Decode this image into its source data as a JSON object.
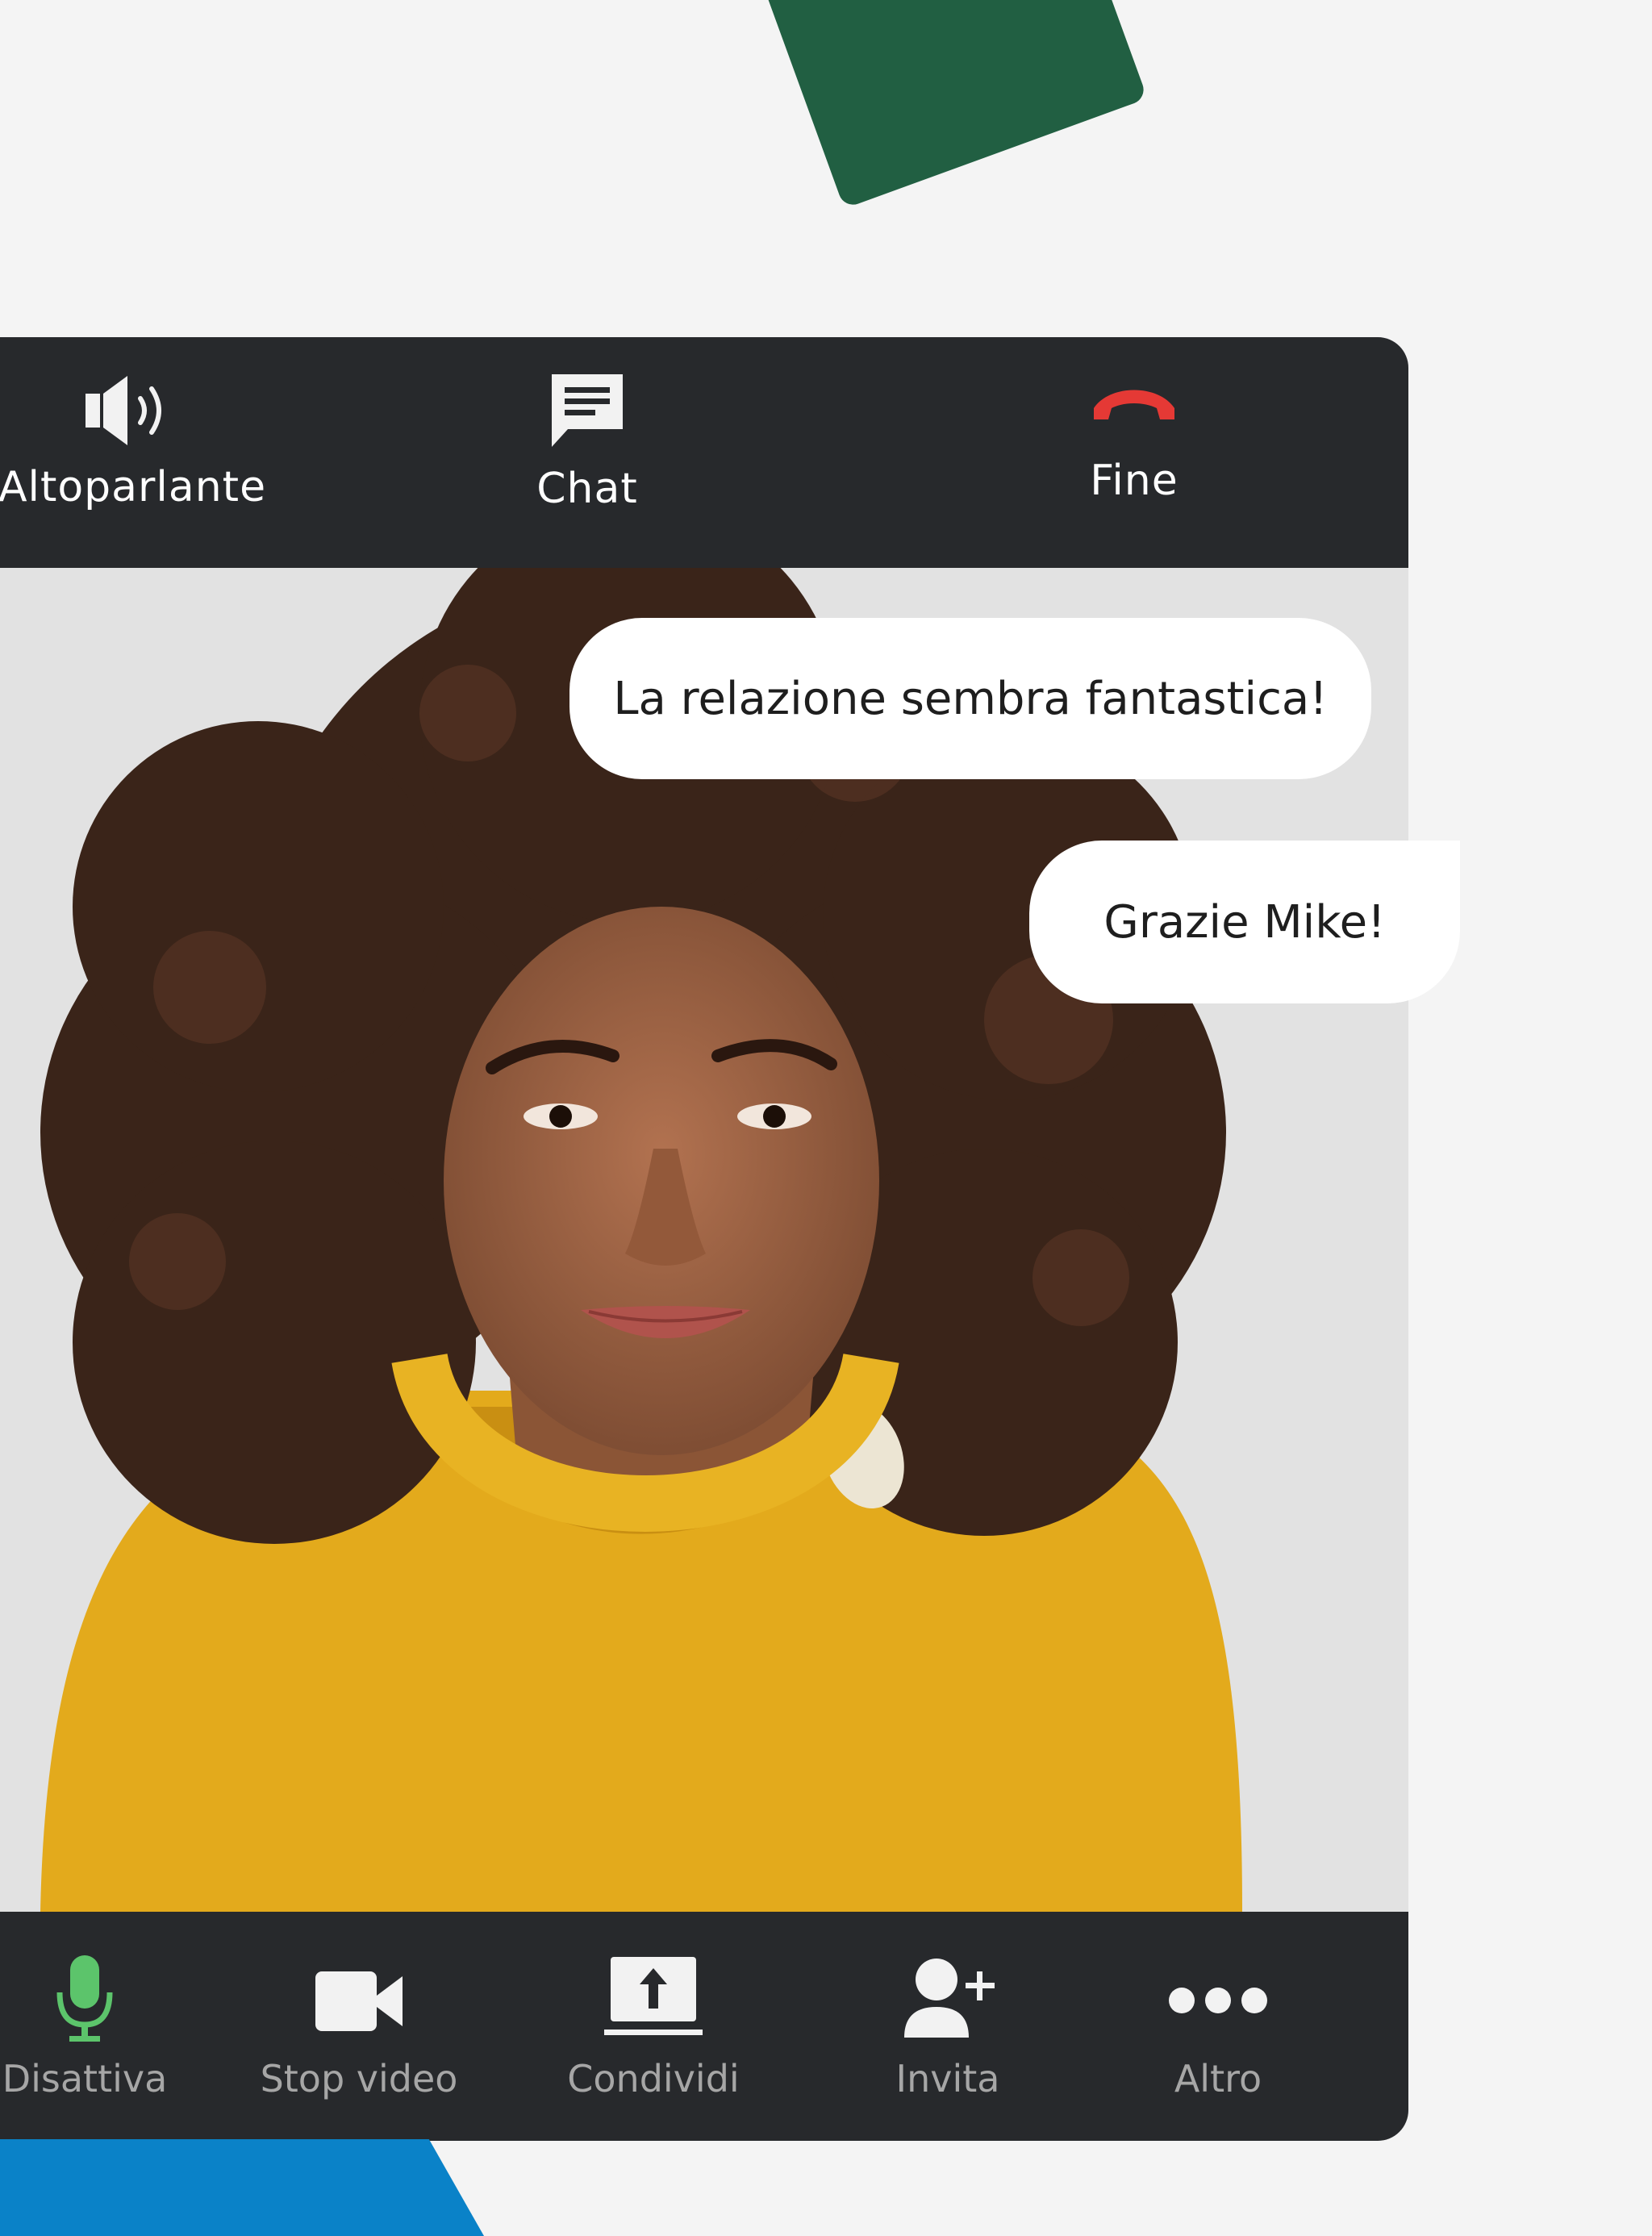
{
  "top_bar": {
    "speaker_label": "Altoparlante",
    "chat_label": "Chat",
    "end_label": "Fine"
  },
  "chat": {
    "messages": [
      {
        "text": "La relazione sembra fantastica!"
      },
      {
        "text": "Grazie Mike!"
      }
    ]
  },
  "bottom_bar": {
    "mute_label": "Disattiva",
    "video_label": "Stop video",
    "share_label": "Condividi",
    "invite_label": "Invita",
    "more_label": "Altro"
  },
  "colors": {
    "bar_background": "#27292c",
    "end_call_red": "#e53935",
    "mic_green": "#5cc46b",
    "accent_green": "#215f42",
    "accent_blue": "#0a82c8"
  }
}
